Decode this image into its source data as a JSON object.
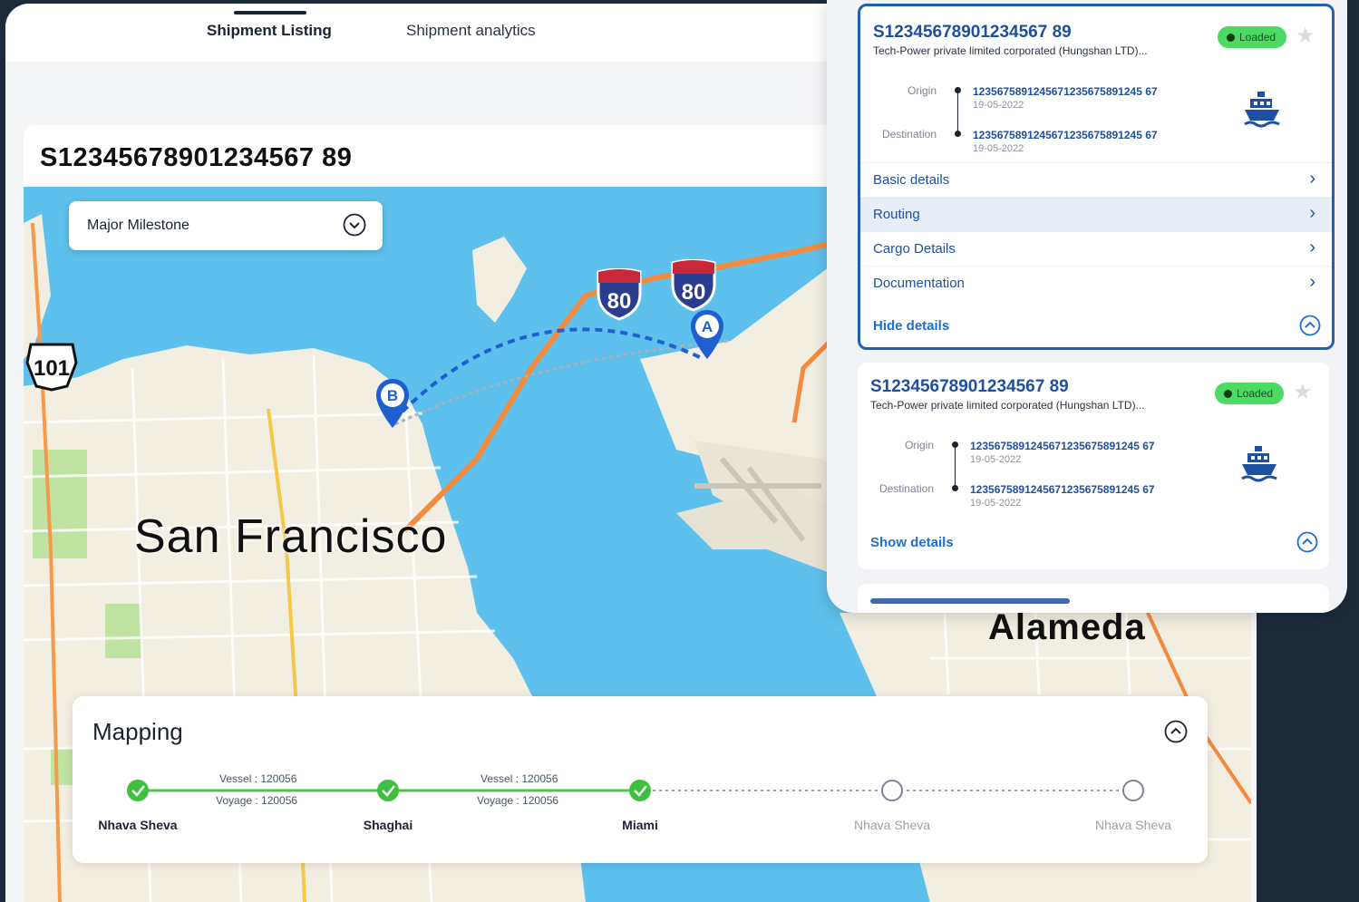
{
  "tabs": {
    "listing": "Shipment Listing",
    "analytics": "Shipment analytics"
  },
  "shipment_title": "S12345678901234567 89",
  "milestone": {
    "label": "Major Milestone"
  },
  "map": {
    "city": "San Francisco",
    "city2": "Alameda",
    "highway_101": "101",
    "interstate_80": "80",
    "marker_a": "A",
    "marker_b": "B"
  },
  "mapping": {
    "title": "Mapping",
    "stops": [
      {
        "name": "Nhava Sheva",
        "status": "done"
      },
      {
        "name": "Shaghai",
        "status": "done"
      },
      {
        "name": "Miami",
        "status": "done"
      },
      {
        "name": "Nhava Sheva",
        "status": "pending"
      },
      {
        "name": "Nhava Sheva",
        "status": "pending"
      }
    ],
    "legs": [
      {
        "vessel": "Vessel   : 120056",
        "voyage": "Voyage   : 120056"
      },
      {
        "vessel": "Vessel   : 120056",
        "voyage": "Voyage   : 120056"
      }
    ]
  },
  "shipments": [
    {
      "id": "S12345678901234567 89",
      "company": "Tech-Power private limited corporated (Hungshan LTD)...",
      "status": "Loaded",
      "origin_label": "Origin",
      "origin_code": "1235675891245671235675891245 67",
      "origin_date": "19-05-2022",
      "dest_label": "Destination",
      "dest_code": "1235675891245671235675891245 67",
      "dest_date": "19-05-2022",
      "details": [
        "Basic details",
        "Routing",
        "Cargo Details",
        "Documentation"
      ],
      "toggle_label": "Hide details"
    },
    {
      "id": "S12345678901234567 89",
      "company": "Tech-Power private limited corporated (Hungshan LTD)...",
      "status": "Loaded",
      "origin_label": "Origin",
      "origin_code": "1235675891245671235675891245 67",
      "origin_date": "19-05-2022",
      "dest_label": "Destination",
      "dest_code": "1235675891245671235675891245 67",
      "dest_date": "19-05-2022",
      "toggle_label": "Show details"
    }
  ],
  "colors": {
    "accent": "#1f4fa0",
    "loaded": "#4cd964",
    "water": "#5ec0ec",
    "land": "#f2eee2",
    "route": "#1f5fd0"
  }
}
